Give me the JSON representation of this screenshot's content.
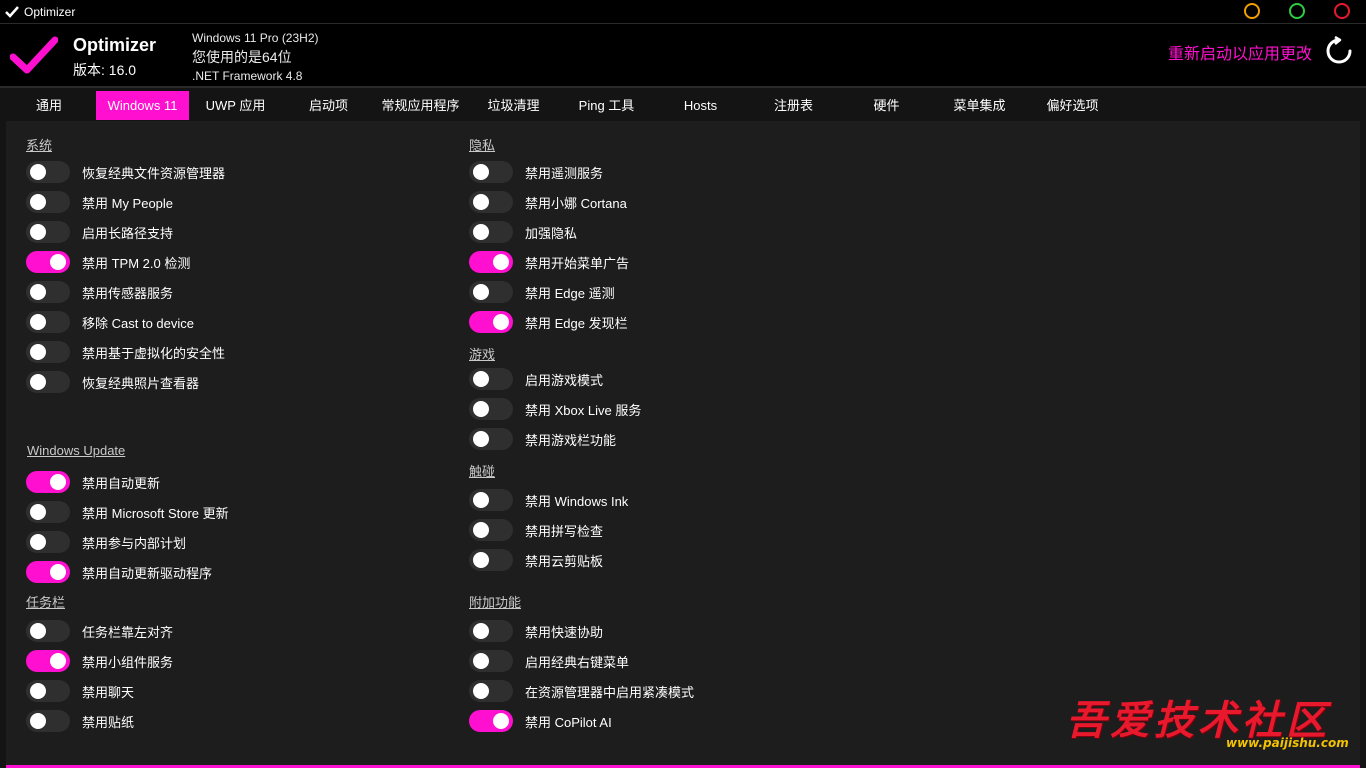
{
  "window": {
    "title": "Optimizer",
    "buttons": [
      {
        "name": "minimize",
        "color": "#f0a000"
      },
      {
        "name": "maximize",
        "color": "#2ecc40"
      },
      {
        "name": "close",
        "color": "#e8192c"
      }
    ]
  },
  "header": {
    "app_name": "Optimizer",
    "version": "版本: 16.0",
    "os": "Windows 11 Pro (23H2)",
    "arch": "您使用的是64位",
    "framework": ".NET Framework 4.8",
    "restart": "重新启动以应用更改",
    "accent": "#ff0fcf"
  },
  "tabs": [
    {
      "label": "通用",
      "active": false
    },
    {
      "label": "Windows 11",
      "active": true
    },
    {
      "label": "UWP 应用",
      "active": false
    },
    {
      "label": "启动项",
      "active": false
    },
    {
      "label": "常规应用程序",
      "active": false
    },
    {
      "label": "垃圾清理",
      "active": false
    },
    {
      "label": "Ping 工具",
      "active": false
    },
    {
      "label": "Hosts",
      "active": false
    },
    {
      "label": "注册表",
      "active": false
    },
    {
      "label": "硬件",
      "active": false
    },
    {
      "label": "菜单集成",
      "active": false
    },
    {
      "label": "偏好选项",
      "active": false
    }
  ],
  "sections": {
    "system": {
      "title": "系统",
      "options": [
        {
          "label": "恢复经典文件资源管理器",
          "on": false
        },
        {
          "label": "禁用 My People",
          "on": false
        },
        {
          "label": "启用长路径支持",
          "on": false
        },
        {
          "label": "禁用 TPM 2.0 检测",
          "on": true
        },
        {
          "label": "禁用传感器服务",
          "on": false
        },
        {
          "label": "移除 Cast to device",
          "on": false
        },
        {
          "label": "禁用基于虚拟化的安全性",
          "on": false
        },
        {
          "label": "恢复经典照片查看器",
          "on": false
        }
      ]
    },
    "windows_update": {
      "title": "Windows Update",
      "options": [
        {
          "label": "禁用自动更新",
          "on": true
        },
        {
          "label": "禁用 Microsoft Store 更新",
          "on": false
        },
        {
          "label": "禁用参与内部计划",
          "on": false
        },
        {
          "label": "禁用自动更新驱动程序",
          "on": true
        }
      ]
    },
    "taskbar": {
      "title": "任务栏",
      "options": [
        {
          "label": "任务栏靠左对齐",
          "on": false
        },
        {
          "label": "禁用小组件服务",
          "on": true
        },
        {
          "label": "禁用聊天",
          "on": false
        },
        {
          "label": "禁用贴纸",
          "on": false
        }
      ]
    },
    "privacy": {
      "title": "隐私",
      "options": [
        {
          "label": "禁用遥测服务",
          "on": false
        },
        {
          "label": "禁用小娜 Cortana",
          "on": false
        },
        {
          "label": "加强隐私",
          "on": false
        },
        {
          "label": "禁用开始菜单广告",
          "on": true
        },
        {
          "label": "禁用 Edge 遥测",
          "on": false
        },
        {
          "label": "禁用 Edge 发现栏",
          "on": true
        }
      ]
    },
    "gaming": {
      "title": "游戏",
      "options": [
        {
          "label": "启用游戏模式",
          "on": false
        },
        {
          "label": "禁用 Xbox Live 服务",
          "on": false
        },
        {
          "label": "禁用游戏栏功能",
          "on": false
        }
      ]
    },
    "touch": {
      "title": "触碰",
      "options": [
        {
          "label": "禁用 Windows Ink",
          "on": false
        },
        {
          "label": "禁用拼写检查",
          "on": false
        },
        {
          "label": "禁用云剪贴板",
          "on": false
        }
      ]
    },
    "extras": {
      "title": "附加功能",
      "options": [
        {
          "label": "禁用快速协助",
          "on": false
        },
        {
          "label": "启用经典右键菜单",
          "on": false
        },
        {
          "label": "在资源管理器中启用紧凑模式",
          "on": false
        },
        {
          "label": "禁用 CoPilot AI",
          "on": true
        }
      ]
    }
  },
  "watermark": {
    "text": "吾爱技术社区",
    "url": "www.paijishu.com"
  }
}
